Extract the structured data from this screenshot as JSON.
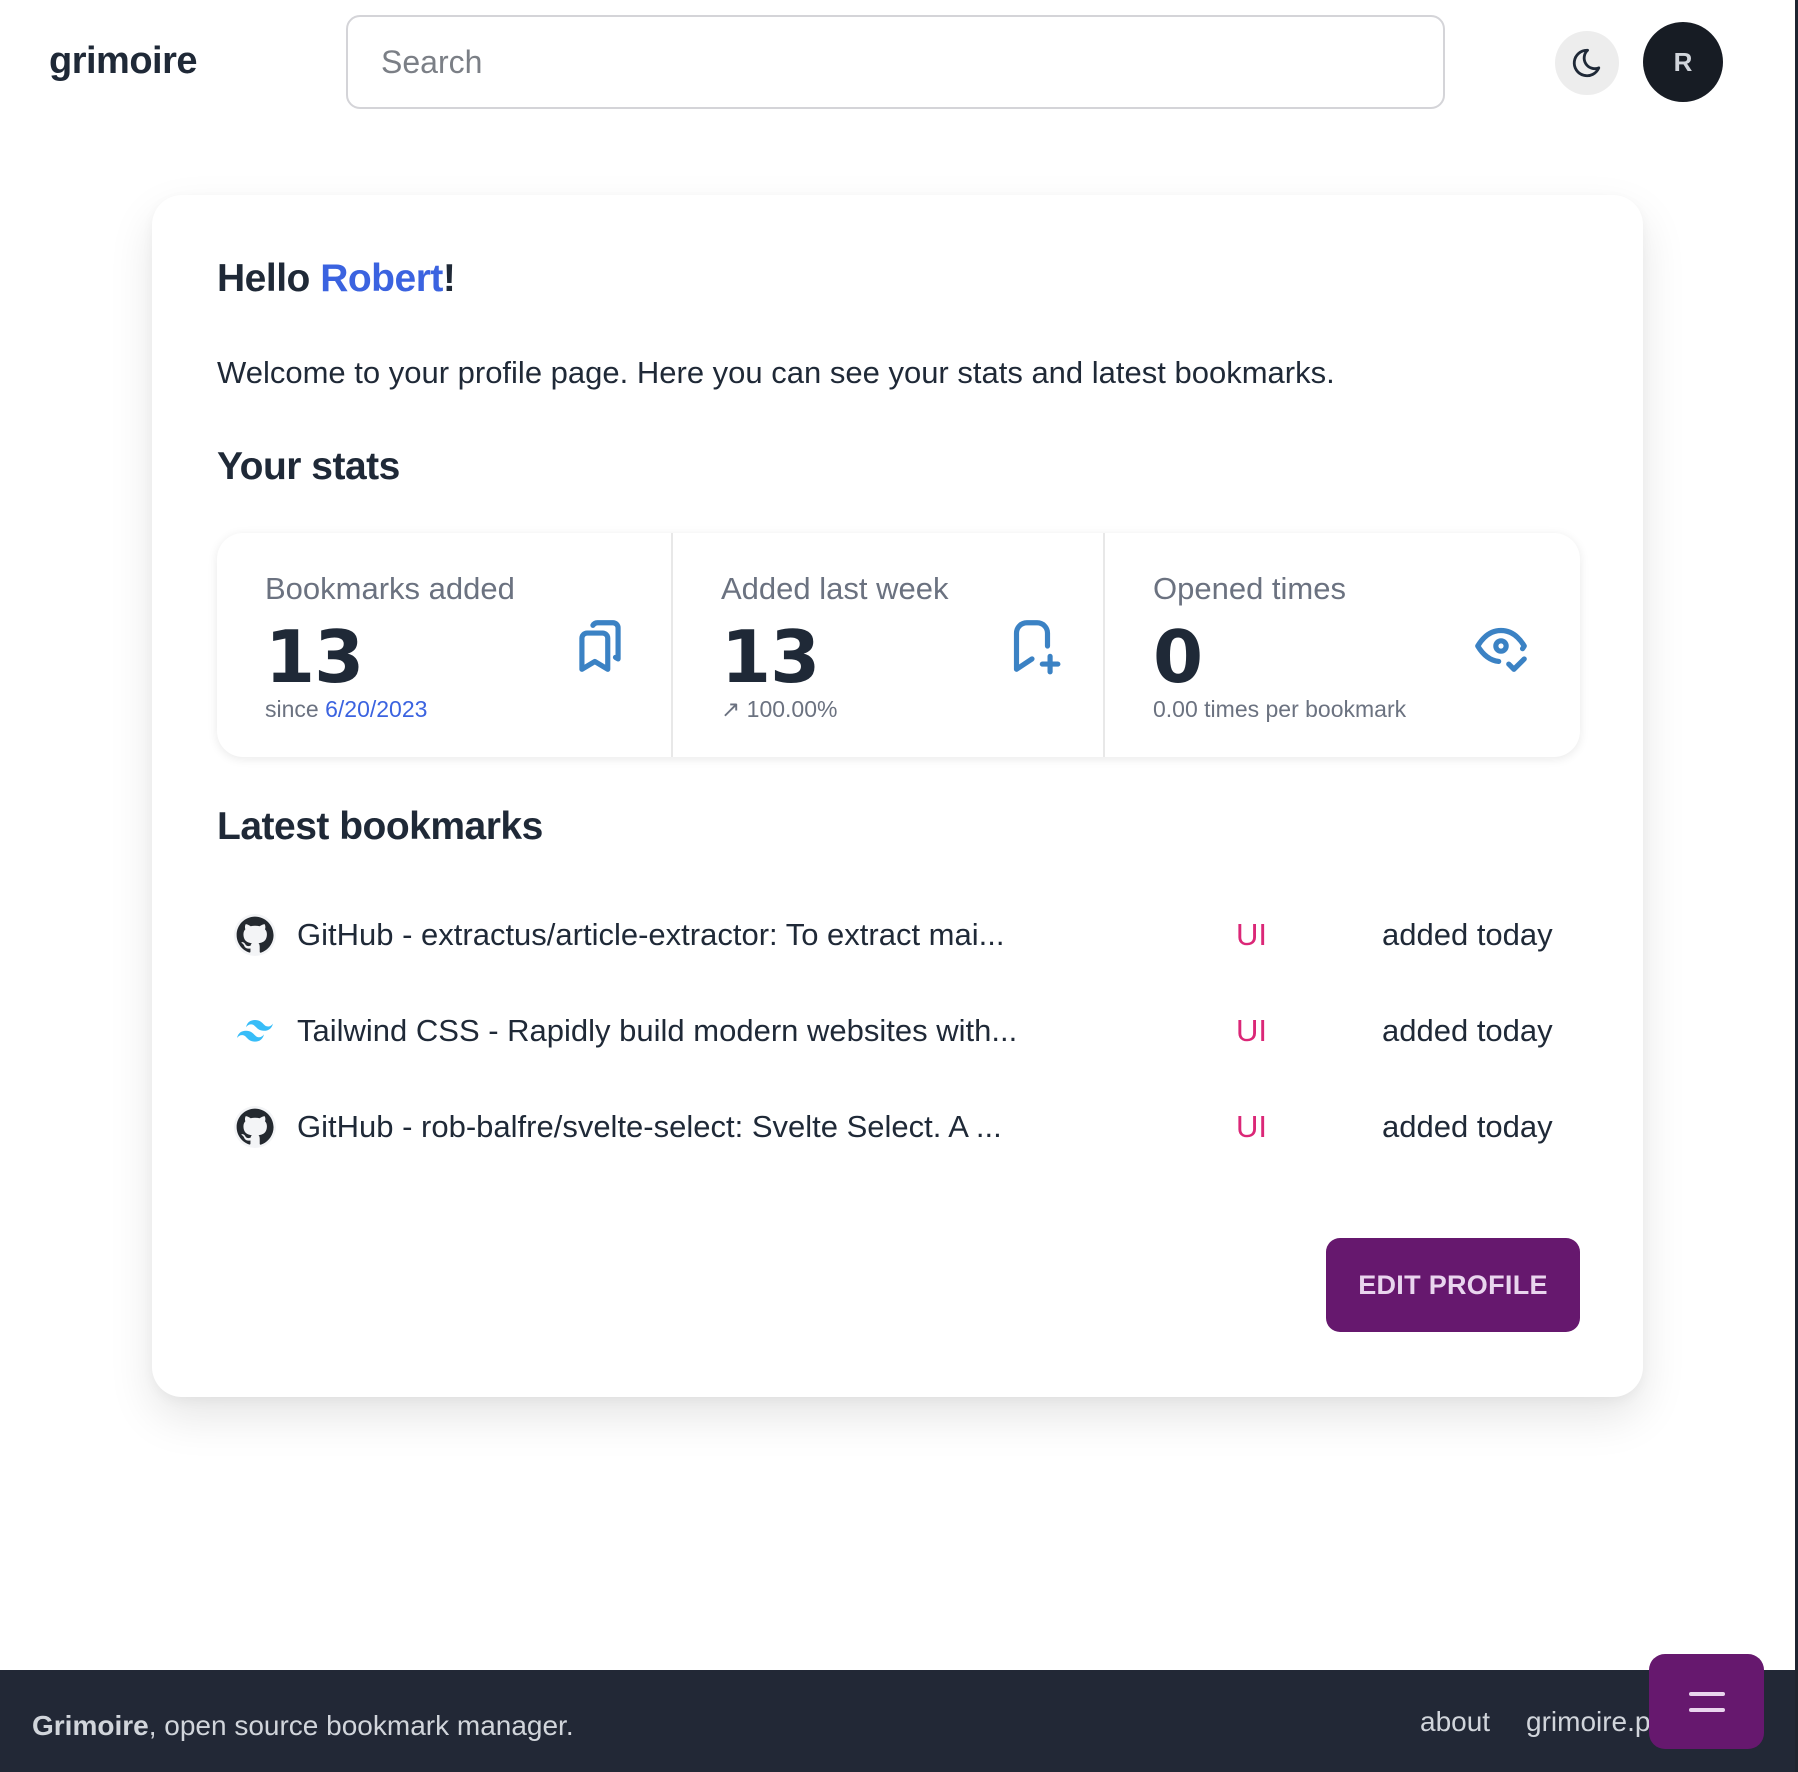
{
  "header": {
    "logo": "grimoire",
    "search_placeholder": "Search",
    "search_value": "",
    "theme_toggle_icon": "moon-icon",
    "avatar_initial": "R"
  },
  "profile": {
    "greeting_prefix": "Hello ",
    "user_name": "Robert",
    "greeting_suffix": "!",
    "welcome_text": "Welcome to your profile page. Here you can see your stats and latest bookmarks.",
    "stats_title": "Your stats",
    "stats": [
      {
        "title": "Bookmarks added",
        "value": "13",
        "desc_prefix": "since ",
        "desc_highlight": "6/20/2023",
        "icon": "bookmarks-icon"
      },
      {
        "title": "Added last week",
        "value": "13",
        "desc_arrow": "↗",
        "desc": "100.00%",
        "icon": "bookmark-plus-icon"
      },
      {
        "title": "Opened times",
        "value": "0",
        "desc": "0.00 times per bookmark",
        "icon": "eye-check-icon"
      }
    ],
    "latest_title": "Latest bookmarks",
    "bookmarks": [
      {
        "icon": "github-icon",
        "title": "GitHub - extractus/article-extractor: To extract mai...",
        "tag": "UI",
        "added": "added today"
      },
      {
        "icon": "tailwind-icon",
        "title": "Tailwind CSS - Rapidly build modern websites with...",
        "tag": "UI",
        "added": "added today"
      },
      {
        "icon": "github-icon",
        "title": "GitHub - rob-balfre/svelte-select: Svelte Select. A ...",
        "tag": "UI",
        "added": "added today"
      }
    ],
    "edit_button": "EDIT PROFILE"
  },
  "footer": {
    "brand": "Grimoire",
    "tagline": ", open source bookmark manager.",
    "links": [
      "about",
      "grimoire.pro"
    ],
    "fab_icon": "menu-icon"
  },
  "colors": {
    "accent_blue": "#3b63e0",
    "tag_pink": "#db2777",
    "primary_purple": "#66186e",
    "icon_blue": "#3b82c4",
    "footer_bg": "#222836"
  }
}
